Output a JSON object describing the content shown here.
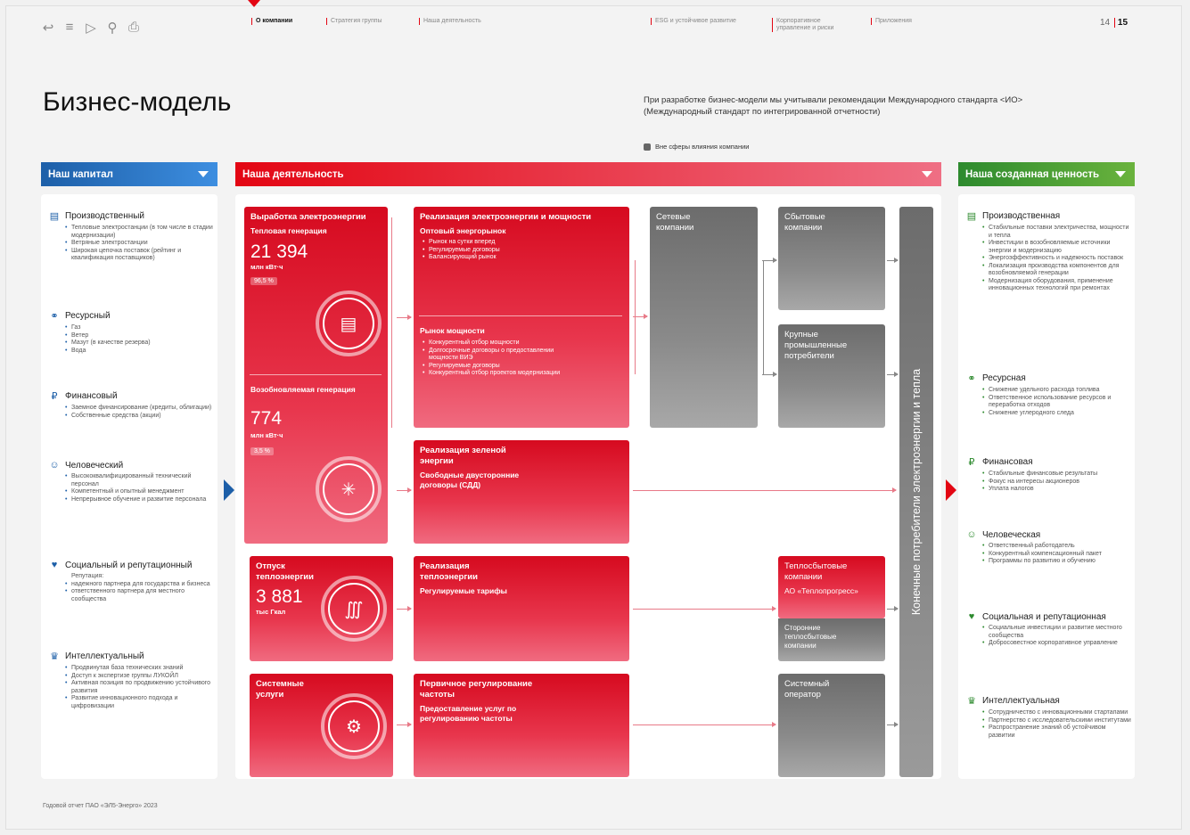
{
  "toolbar": {
    "icons": [
      "back-icon",
      "menu-icon",
      "forward-icon",
      "search-icon",
      "print-icon"
    ]
  },
  "nav": [
    {
      "label": "О компании",
      "active": true
    },
    {
      "label": "Стратегия группы"
    },
    {
      "label": "Наша деятельность"
    },
    {
      "label": "ESG и устойчивое развитие"
    },
    {
      "label": "Корпоративное управление и риски"
    },
    {
      "label": "Приложения"
    }
  ],
  "pages": {
    "left": "14",
    "right": "15"
  },
  "title": "Бизнес-модель",
  "intro": "При разработке бизнес-модели мы учитывали рекомендации Международного стандарта <ИО> (Международный стандарт по интегрированной отчетности)",
  "legend": "Вне сферы влияния компании",
  "headers": {
    "capital": "Наш капитал",
    "activity": "Наша деятельность",
    "value": "Наша созданная ценность"
  },
  "capital": [
    {
      "title": "Производственный",
      "icon": "factory-icon",
      "items": [
        "Тепловые электростанции (в том числе в стадии модернизации)",
        "Ветряные электростанции",
        "Широкая цепочка поставок (рейтинг и квалификация поставщиков)"
      ]
    },
    {
      "title": "Ресурсный",
      "icon": "resource-icon",
      "items": [
        "Газ",
        "Ветер",
        "Мазут (в качестве резерва)",
        "Вода"
      ]
    },
    {
      "title": "Финансовый",
      "icon": "ruble-icon",
      "items": [
        "Заемное финансирование (кредиты, облигации)",
        "Собственные средства (акции)"
      ]
    },
    {
      "title": "Человеческий",
      "icon": "people-icon",
      "items": [
        "Высококвалифицированный технический персонал",
        "Компетентный и опытный менеджмент",
        "Непрерывное обучение и развитие персонала"
      ]
    },
    {
      "title": "Социальный и репутационный",
      "icon": "heart-hand-icon",
      "sub": "Репутация:",
      "items": [
        "надежного партнера для государства и бизнеса",
        "ответственного партнера для местного сообщества"
      ]
    },
    {
      "title": "Интеллектуальный",
      "icon": "idea-icon",
      "items": [
        "Продвинутая база технических знаний",
        "Доступ к экспертизе группы ЛУКОЙЛ",
        "Активная позиция по продвижению устойчивого развития",
        "Развитие инновационного подхода и цифровизации"
      ]
    }
  ],
  "value": [
    {
      "title": "Производственная",
      "icon": "factory-icon",
      "items": [
        "Стабильные поставки электричества, мощности и тепла",
        "Инвестиции в возобновляемые источники энергии и модернизацию",
        "Энергоэффективность и надежность поставок",
        "Локализация производства компонентов для возобновляемой генерации",
        "Модернизация оборудования, применение инновационных технологий при ремонтах"
      ]
    },
    {
      "title": "Ресурсная",
      "icon": "resource-icon",
      "items": [
        "Снижение удельного расхода топлива",
        "Ответственное использование ресурсов и переработка отходов",
        "Снижение углеродного следа"
      ]
    },
    {
      "title": "Финансовая",
      "icon": "ruble-icon",
      "items": [
        "Стабильные финансовые результаты",
        "Фокус на интересы акционеров",
        "Уплата налогов"
      ]
    },
    {
      "title": "Человеческая",
      "icon": "people-icon",
      "items": [
        "Ответственный работодатель",
        "Конкурентный компенсационный пакет",
        "Программы по развитию и обучению"
      ]
    },
    {
      "title": "Социальная и репутационная",
      "icon": "heart-hand-icon",
      "items": [
        "Социальные инвестиции и развитие местного сообщества",
        "Добросовестное корпоративное управление"
      ]
    },
    {
      "title": "Интеллектуальная",
      "icon": "idea-icon",
      "items": [
        "Сотрудничество с инновационными стартапами",
        "Партнерство с исследовательскими институтами",
        "Распространение знаний об устойчивом развитии"
      ]
    }
  ],
  "gen": {
    "title": "Выработка электроэнергии",
    "thermal": {
      "label": "Тепловая генерация",
      "value": "21 394",
      "unit": "млн кВт·ч",
      "share": "96,5 %"
    },
    "renew": {
      "label": "Возобновляемая генерация",
      "value": "774",
      "unit": "млн кВт·ч",
      "share": "3,5 %"
    }
  },
  "sales": {
    "title": "Реализация электроэнергии и мощности",
    "wholesale": "Оптовый энергорынок",
    "wholesale_items": [
      "Рынок на сутки вперед",
      "Регулируемые договоры",
      "Балансирующий рынок"
    ],
    "capacity": "Рынок мощности",
    "capacity_items": [
      "Конкурентный отбор мощности",
      "Долгосрочные договоры о предоставлении мощности ВИЭ",
      "Регулируемые договоры",
      "Конкурентный отбор проектов модернизации"
    ]
  },
  "green": {
    "title": "Реализация зеленой энергии",
    "sub": "Свободные двусторонние договоры (СДД)"
  },
  "heat": {
    "title": "Отпуск теплоэнергии",
    "value": "3 881",
    "unit": "тыс Гкал"
  },
  "heatsale": {
    "title": "Реализация теплоэнергии",
    "sub": "Регулируемые тарифы"
  },
  "sys": {
    "title": "Системные услуги"
  },
  "freq": {
    "title": "Первичное регулирование частоты",
    "sub": "Предоставление услуг по регулированию частоты"
  },
  "grid": "Сетевые компании",
  "retail": "Сбытовые компании",
  "industrial": "Крупные промышленные потребители",
  "heatretail": {
    "title": "Теплосбытовые компании",
    "sub": "АО «Теплопрогресс»",
    "other": "Сторонние теплосбытовые компании"
  },
  "operator": "Системный оператор",
  "consumers": "Конечные потребители электроэнергии и тепла",
  "footer": "Годовой отчет ПАО «ЭЛ5-Энерго» 2023"
}
